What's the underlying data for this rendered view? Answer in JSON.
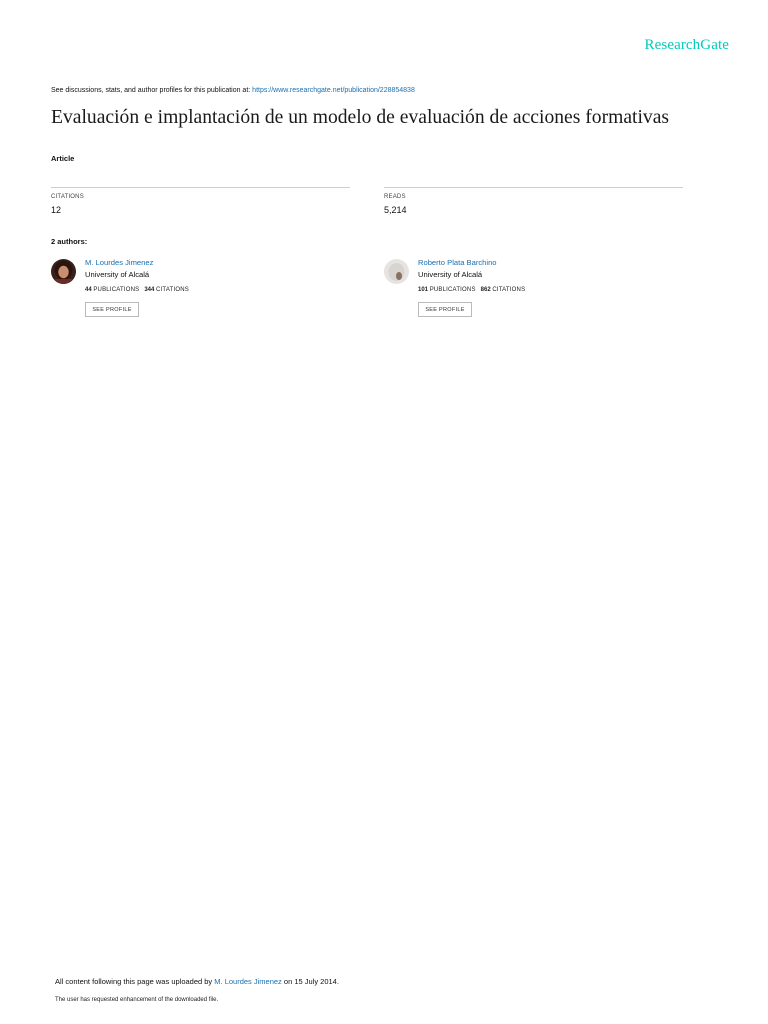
{
  "header": {
    "brand": "ResearchGate",
    "discussion_prefix": "See discussions, stats, and author profiles for this publication at: ",
    "discussion_link": "https://www.researchgate.net/publication/228854838"
  },
  "publication": {
    "title": "Evaluación e implantación de un modelo de evaluación de acciones formativas",
    "type": "Article"
  },
  "stats": {
    "citations_label": "CITATIONS",
    "citations_value": "12",
    "reads_label": "READS",
    "reads_value": "5,214"
  },
  "authors_heading": "2 authors:",
  "authors": [
    {
      "name": "M. Lourdes Jimenez",
      "institution": "University of Alcalá",
      "publications_count": "44",
      "publications_label": "PUBLICATIONS",
      "citations_count": "344",
      "citations_label": "CITATIONS",
      "button_label": "SEE PROFILE"
    },
    {
      "name": "Roberto Plata Barchino",
      "institution": "University of Alcalá",
      "publications_count": "101",
      "publications_label": "PUBLICATIONS",
      "citations_count": "862",
      "citations_label": "CITATIONS",
      "button_label": "SEE PROFILE"
    }
  ],
  "footer": {
    "uploaded_prefix": "All content following this page was uploaded by ",
    "uploader": "M. Lourdes Jimenez",
    "uploaded_suffix": " on 15 July 2014.",
    "note": "The user has requested enhancement of the downloaded file."
  },
  "colors": {
    "brand": "#00ccbb",
    "link": "#1a6fb0"
  }
}
